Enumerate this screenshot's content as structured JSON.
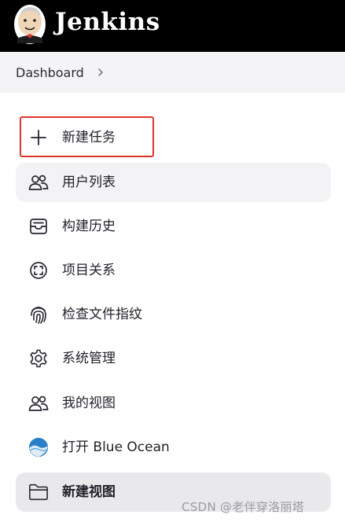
{
  "header": {
    "brand": "Jenkins",
    "logo_icon": "jenkins-butler-logo",
    "background": "#000000"
  },
  "breadcrumb": {
    "items": [
      "Dashboard"
    ],
    "separator_icon": "chevron-right-icon"
  },
  "sidebar": {
    "items": [
      {
        "label": "新建任务",
        "icon": "plus-icon",
        "highlighted": true
      },
      {
        "label": "用户列表",
        "icon": "people-icon"
      },
      {
        "label": "构建历史",
        "icon": "inbox-icon"
      },
      {
        "label": "项目关系",
        "icon": "relationship-icon"
      },
      {
        "label": "检查文件指纹",
        "icon": "fingerprint-icon"
      },
      {
        "label": "系统管理",
        "icon": "gear-icon"
      },
      {
        "label": "我的视图",
        "icon": "people-icon"
      },
      {
        "label": "打开 Blue Ocean",
        "icon": "blue-ocean-icon"
      },
      {
        "label": "新建视图",
        "icon": "folder-icon",
        "active": true
      }
    ]
  },
  "annotation": {
    "highlight_color": "#e0342b"
  },
  "watermark": "CSDN @老伴穿洛丽塔"
}
